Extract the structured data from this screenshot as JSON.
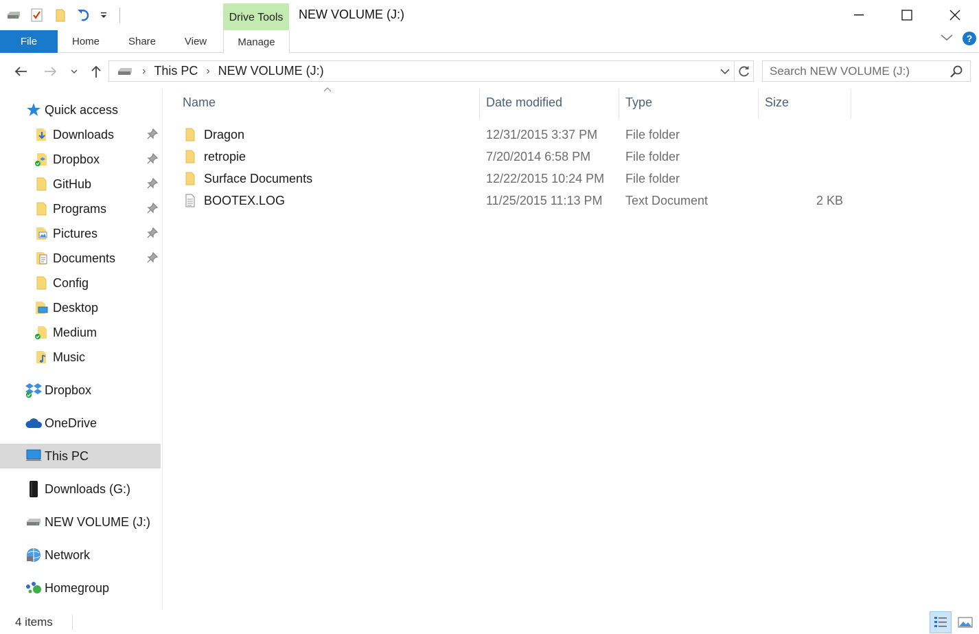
{
  "titlebar": {
    "title": "NEW VOLUME (J:)",
    "context_tab": "Drive Tools",
    "quick_access_toolbar": [
      "drive-icon",
      "properties-icon",
      "new-folder-icon",
      "undo-icon",
      "customize-dropdown-icon"
    ],
    "window_controls": [
      "minimize",
      "maximize",
      "close"
    ]
  },
  "ribbon": {
    "tabs": [
      "File",
      "Home",
      "Share",
      "View",
      "Manage"
    ],
    "active_context_tab": "Manage",
    "help_label": "?"
  },
  "address": {
    "crumbs": [
      "This PC",
      "NEW VOLUME (J:)"
    ],
    "search_placeholder": "Search NEW VOLUME (J:)"
  },
  "navigation": {
    "quick_access": {
      "label": "Quick access",
      "items": [
        {
          "label": "Downloads",
          "icon": "downloads-folder-icon",
          "pinned": true
        },
        {
          "label": "Dropbox",
          "icon": "dropbox-folder-icon",
          "pinned": true
        },
        {
          "label": "GitHub",
          "icon": "folder-icon",
          "pinned": true
        },
        {
          "label": "Programs",
          "icon": "folder-icon",
          "pinned": true
        },
        {
          "label": "Pictures",
          "icon": "pictures-folder-icon",
          "pinned": true
        },
        {
          "label": "Documents",
          "icon": "documents-folder-icon",
          "pinned": true
        },
        {
          "label": "Config",
          "icon": "folder-icon",
          "pinned": false
        },
        {
          "label": "Desktop",
          "icon": "desktop-folder-icon",
          "pinned": false
        },
        {
          "label": "Medium",
          "icon": "synced-folder-icon",
          "pinned": false
        },
        {
          "label": "Music",
          "icon": "music-folder-icon",
          "pinned": false
        }
      ]
    },
    "roots": [
      {
        "label": "Dropbox",
        "icon": "dropbox-icon",
        "selected": false
      },
      {
        "label": "OneDrive",
        "icon": "onedrive-icon",
        "selected": false
      },
      {
        "label": "This PC",
        "icon": "this-pc-icon",
        "selected": true
      },
      {
        "label": "Downloads (G:)",
        "icon": "external-drive-icon",
        "selected": false
      },
      {
        "label": "NEW VOLUME (J:)",
        "icon": "drive-icon",
        "selected": false
      },
      {
        "label": "Network",
        "icon": "network-icon",
        "selected": false
      },
      {
        "label": "Homegroup",
        "icon": "homegroup-icon",
        "selected": false
      }
    ]
  },
  "file_list": {
    "columns": [
      "Name",
      "Date modified",
      "Type",
      "Size"
    ],
    "sorted_by": "Name",
    "rows": [
      {
        "name": "Dragon",
        "date": "12/31/2015 3:37 PM",
        "type": "File folder",
        "size": "",
        "icon": "folder-icon"
      },
      {
        "name": "retropie",
        "date": "7/20/2014 6:58 PM",
        "type": "File folder",
        "size": "",
        "icon": "folder-icon"
      },
      {
        "name": "Surface Documents",
        "date": "12/22/2015 10:24 PM",
        "type": "File folder",
        "size": "",
        "icon": "folder-icon"
      },
      {
        "name": "BOOTEX.LOG",
        "date": "11/25/2015 11:13 PM",
        "type": "Text Document",
        "size": "2 KB",
        "icon": "text-file-icon"
      }
    ]
  },
  "status": {
    "item_count": "4 items",
    "active_view": "details"
  },
  "colors": {
    "file_tab": "#1979ca",
    "drive_tools_tab": "#c3eab0",
    "selected_nav": "#d9d9d9",
    "header_text": "#4c607a",
    "folder_yellow": "#f8d775"
  }
}
